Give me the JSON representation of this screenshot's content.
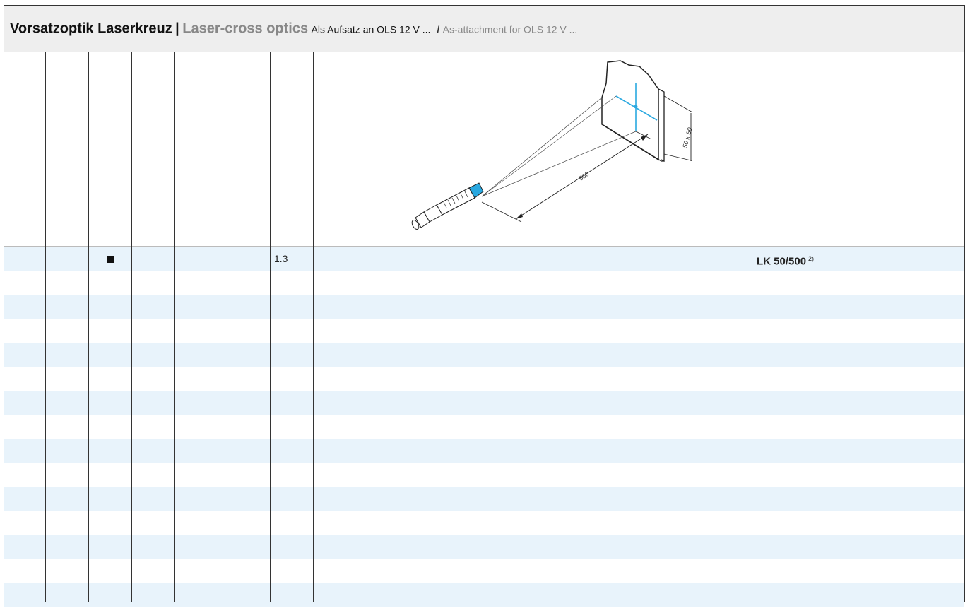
{
  "header": {
    "title_de": "Vorsatzoptik Laserkreuz",
    "separator": "|",
    "title_en": "Laser-cross optics",
    "subtitle_de": "Als Aufsatz an OLS 12 V ...",
    "slash": "/",
    "subtitle_en": "As-attachment for OLS 12 V ..."
  },
  "drawing": {
    "distance_label": "500",
    "size_label": "50 x 50",
    "accent_color": "#29a8e0"
  },
  "row": {
    "marker": "■",
    "value": "1.3",
    "product_code": "LK 50/500",
    "footnote": "2)"
  },
  "colors": {
    "stripe": "#e8f3fb",
    "header_bg": "#eeeeee",
    "muted_text": "#888888"
  }
}
